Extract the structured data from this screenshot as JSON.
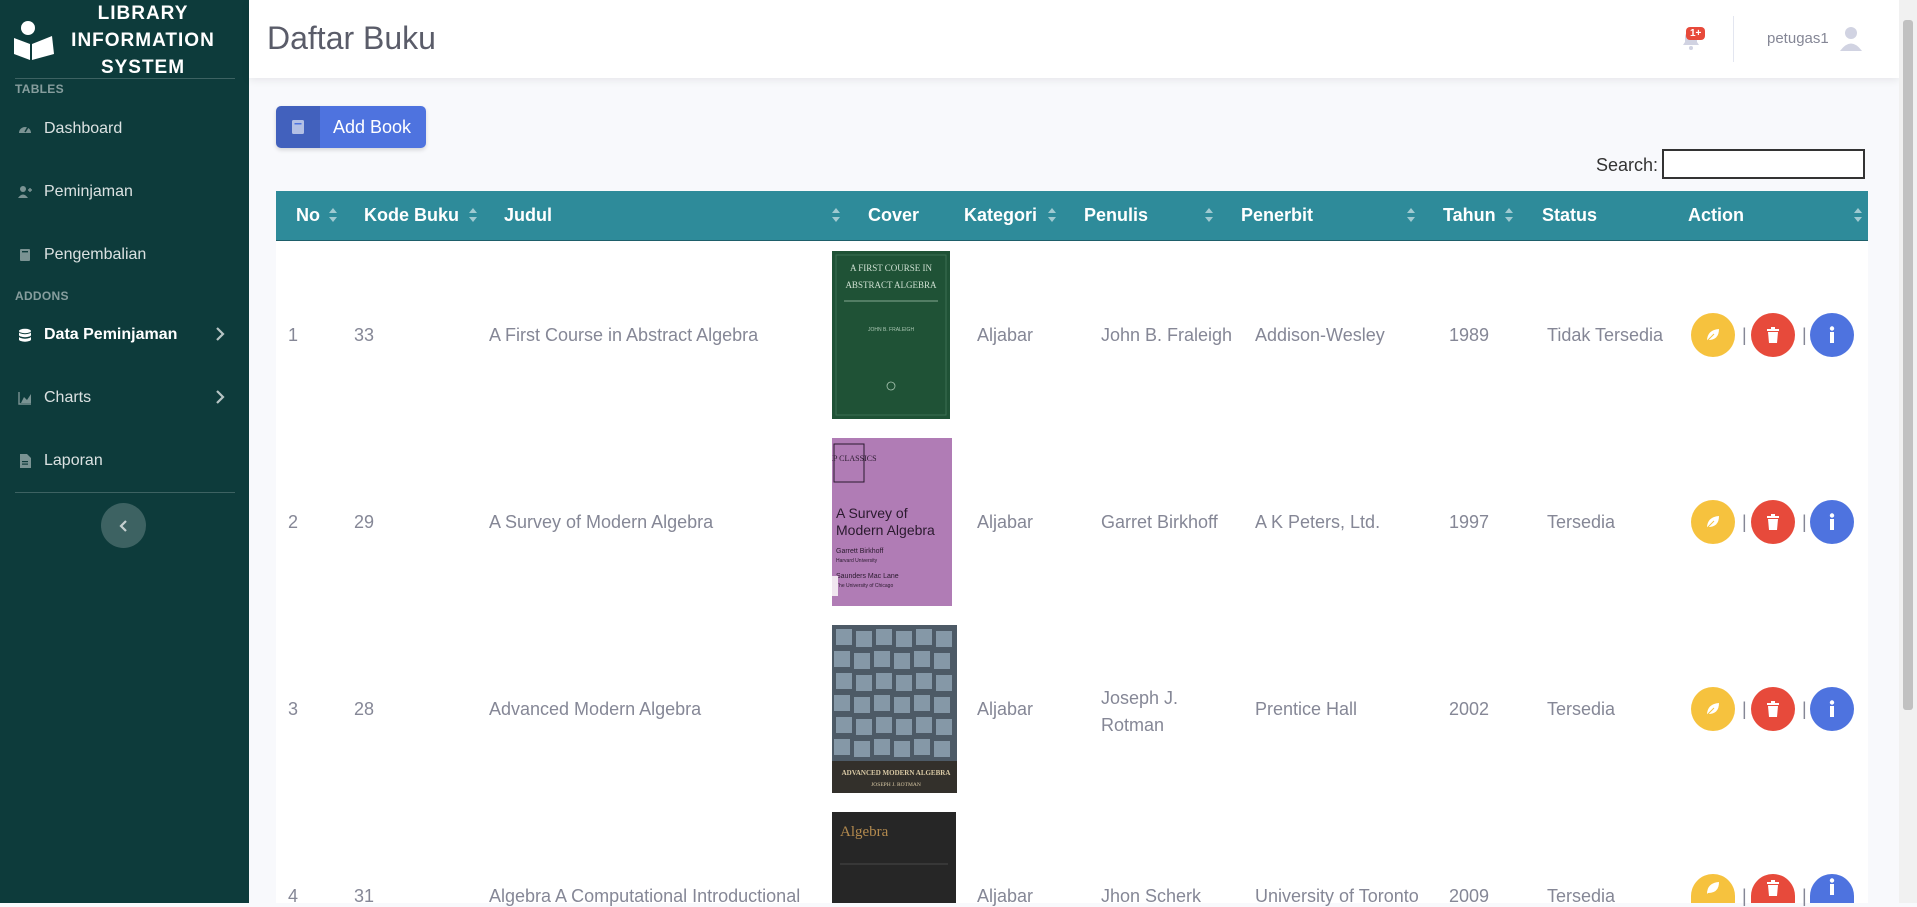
{
  "brand": {
    "line1": "LIBRARY",
    "line2": "INFORMATION",
    "line3": "SYSTEM"
  },
  "sidebar": {
    "heading_tables": "TABLES",
    "heading_addons": "ADDONS",
    "items": [
      {
        "label": "Dashboard",
        "icon": "tachometer-icon"
      },
      {
        "label": "Peminjaman",
        "icon": "user-plus-icon"
      },
      {
        "label": "Pengembalian",
        "icon": "book-icon"
      },
      {
        "label": "Data Peminjaman",
        "icon": "database-icon",
        "active": true
      },
      {
        "label": "Charts",
        "icon": "chart-area-icon"
      },
      {
        "label": "Laporan",
        "icon": "file-icon"
      }
    ]
  },
  "topbar": {
    "title": "Daftar Buku",
    "badge": "1+",
    "username": "petugas1"
  },
  "toolbar": {
    "add_label": "Add Book",
    "search_label": "Search:",
    "search_value": ""
  },
  "table": {
    "headers": {
      "no": "No",
      "kode": "Kode Buku",
      "judul": "Judul",
      "cover": "Cover",
      "kategori": "Kategori",
      "penulis": "Penulis",
      "penerbit": "Penerbit",
      "tahun": "Tahun",
      "status": "Status",
      "action": "Action"
    },
    "rows": [
      {
        "no": "1",
        "kode": "33",
        "judul": "A First Course in Abstract Algebra",
        "kategori": "Aljabar",
        "penulis": "John B. Fraleigh",
        "penerbit": "Addison-Wesley",
        "tahun": "1989",
        "status": "Tidak Tersedia",
        "cover": {
          "l1": "A FIRST COURSE IN",
          "l2": "ABSTRACT ALGEBRA",
          "l3": "JOHN B. FRALEIGH"
        }
      },
      {
        "no": "2",
        "kode": "29",
        "judul": "A Survey of Modern Algebra",
        "kategori": "Aljabar",
        "penulis": "Garret Birkhoff",
        "penerbit": "A K Peters, Ltd.",
        "tahun": "1997",
        "status": "Tersedia",
        "cover": {
          "l1": "AKP CLASSICS",
          "l2": "A Survey of",
          "l3": "Modern Algebra",
          "l4": "Garrett Birkhoff",
          "l5": "Harvard University",
          "l6": "Saunders Mac Lane",
          "l7": "The University of Chicago"
        }
      },
      {
        "no": "3",
        "kode": "28",
        "judul": "Advanced Modern Algebra",
        "kategori": "Aljabar",
        "penulis": "Joseph J. Rotman",
        "penerbit": "Prentice Hall",
        "tahun": "2002",
        "status": "Tersedia",
        "cover": {
          "l1": "ADVANCED MODERN ALGEBRA",
          "l2": "JOSEPH J. ROTMAN"
        }
      },
      {
        "no": "4",
        "kode": "31",
        "judul": "Algebra A Computational Introductional",
        "kategori": "Aljabar",
        "penulis": "Jhon Scherk",
        "penerbit": "University of Toronto",
        "tahun": "2009",
        "status": "Tersedia",
        "cover": {
          "l1": "Algebra"
        }
      }
    ]
  },
  "colors": {
    "sidebar": "#0d3b3b",
    "header": "#2e8b9a",
    "primary": "#4e73df",
    "warning": "#f6c23e",
    "danger": "#e74a3b"
  }
}
